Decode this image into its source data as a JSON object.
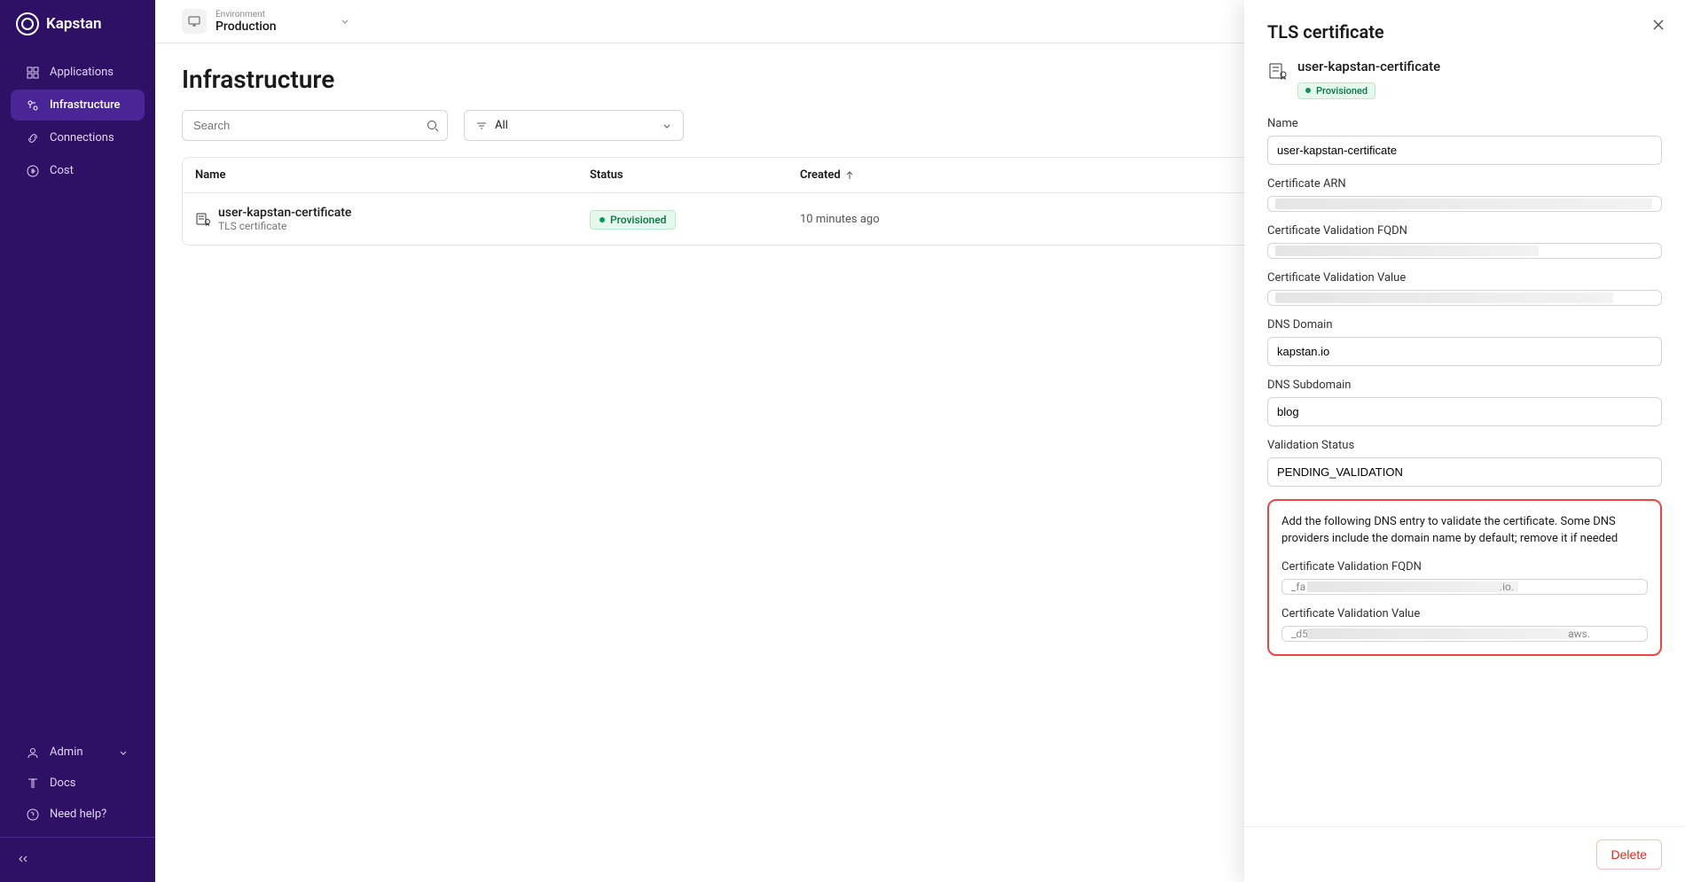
{
  "brand": "Kapstan",
  "sidebar": {
    "items": [
      {
        "label": "Applications"
      },
      {
        "label": "Infrastructure"
      },
      {
        "label": "Connections"
      },
      {
        "label": "Cost"
      }
    ],
    "bottom": [
      {
        "label": "Admin"
      },
      {
        "label": "Docs"
      },
      {
        "label": "Need help?"
      }
    ]
  },
  "env": {
    "label": "Environment",
    "value": "Production"
  },
  "page_title": "Infrastructure",
  "search_placeholder": "Search",
  "filter_value": "All",
  "table": {
    "headers": {
      "name": "Name",
      "status": "Status",
      "created": "Created"
    },
    "rows": [
      {
        "name": "user-kapstan-certificate",
        "subtitle": "TLS certificate",
        "status": "Provisioned",
        "created": "10 minutes ago"
      }
    ]
  },
  "panel": {
    "title": "TLS certificate",
    "cert_name": "user-kapstan-certificate",
    "status": "Provisioned",
    "fields": {
      "name": {
        "label": "Name",
        "value": "user-kapstan-certificate"
      },
      "arn": {
        "label": "Certificate ARN",
        "value": ""
      },
      "fqdn": {
        "label": "Certificate Validation FQDN",
        "value": ""
      },
      "val": {
        "label": "Certificate Validation Value",
        "value": ""
      },
      "dns_domain": {
        "label": "DNS Domain",
        "value": "kapstan.io"
      },
      "dns_subdomain": {
        "label": "DNS Subdomain",
        "value": "blog"
      },
      "validation_status": {
        "label": "Validation Status",
        "value": "PENDING_VALIDATION"
      }
    },
    "callout": {
      "text": "Add the following DNS entry to validate the certificate. Some DNS providers include the domain name by default; remove it if needed",
      "fqdn_label": "Certificate Validation FQDN",
      "fqdn_left": "_fa",
      "fqdn_right": ".io.",
      "value_label": "Certificate Validation Value",
      "value_left": "_d5",
      "value_right": "aws."
    },
    "delete_label": "Delete"
  }
}
